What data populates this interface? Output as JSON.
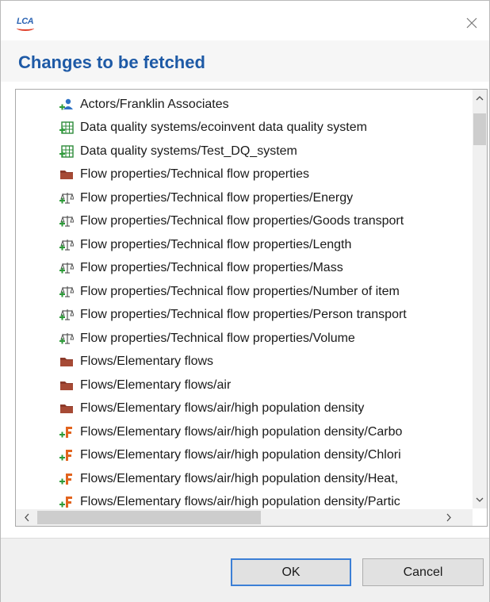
{
  "window": {
    "app_logo_text": "LCA",
    "close_icon": "close-icon"
  },
  "header": {
    "title": "Changes to be fetched"
  },
  "list": {
    "items": [
      {
        "icon": "actor-add-icon",
        "label": "Actors/Franklin Associates"
      },
      {
        "icon": "dq-system-add-icon",
        "label": "Data quality systems/ecoinvent data quality system"
      },
      {
        "icon": "dq-system-add-icon",
        "label": "Data quality systems/Test_DQ_system"
      },
      {
        "icon": "folder-icon",
        "label": "Flow properties/Technical flow properties"
      },
      {
        "icon": "flow-property-add-icon",
        "label": "Flow properties/Technical flow properties/Energy"
      },
      {
        "icon": "flow-property-add-icon",
        "label": "Flow properties/Technical flow properties/Goods transport"
      },
      {
        "icon": "flow-property-add-icon",
        "label": "Flow properties/Technical flow properties/Length"
      },
      {
        "icon": "flow-property-add-icon",
        "label": "Flow properties/Technical flow properties/Mass"
      },
      {
        "icon": "flow-property-add-icon",
        "label": "Flow properties/Technical flow properties/Number of item"
      },
      {
        "icon": "flow-property-add-icon",
        "label": "Flow properties/Technical flow properties/Person transport"
      },
      {
        "icon": "flow-property-add-icon",
        "label": "Flow properties/Technical flow properties/Volume"
      },
      {
        "icon": "folder-icon",
        "label": "Flows/Elementary flows"
      },
      {
        "icon": "folder-icon",
        "label": "Flows/Elementary flows/air"
      },
      {
        "icon": "folder-icon",
        "label": "Flows/Elementary flows/air/high population density"
      },
      {
        "icon": "flow-add-icon",
        "label": "Flows/Elementary flows/air/high population density/Carbo"
      },
      {
        "icon": "flow-add-icon",
        "label": "Flows/Elementary flows/air/high population density/Chlori"
      },
      {
        "icon": "flow-add-icon",
        "label": "Flows/Elementary flows/air/high population density/Heat,"
      },
      {
        "icon": "flow-add-icon",
        "label": "Flows/Elementary flows/air/high population density/Partic"
      }
    ],
    "scroll_up_glyph": "^",
    "scroll_down_glyph": "v",
    "scroll_left_glyph": "<",
    "scroll_right_glyph": ">"
  },
  "buttons": {
    "ok_label": "OK",
    "cancel_label": "Cancel"
  },
  "colors": {
    "title_blue": "#1e5aa6",
    "folder_brown": "#8c3a2a",
    "plus_green": "#2e9b3a"
  }
}
